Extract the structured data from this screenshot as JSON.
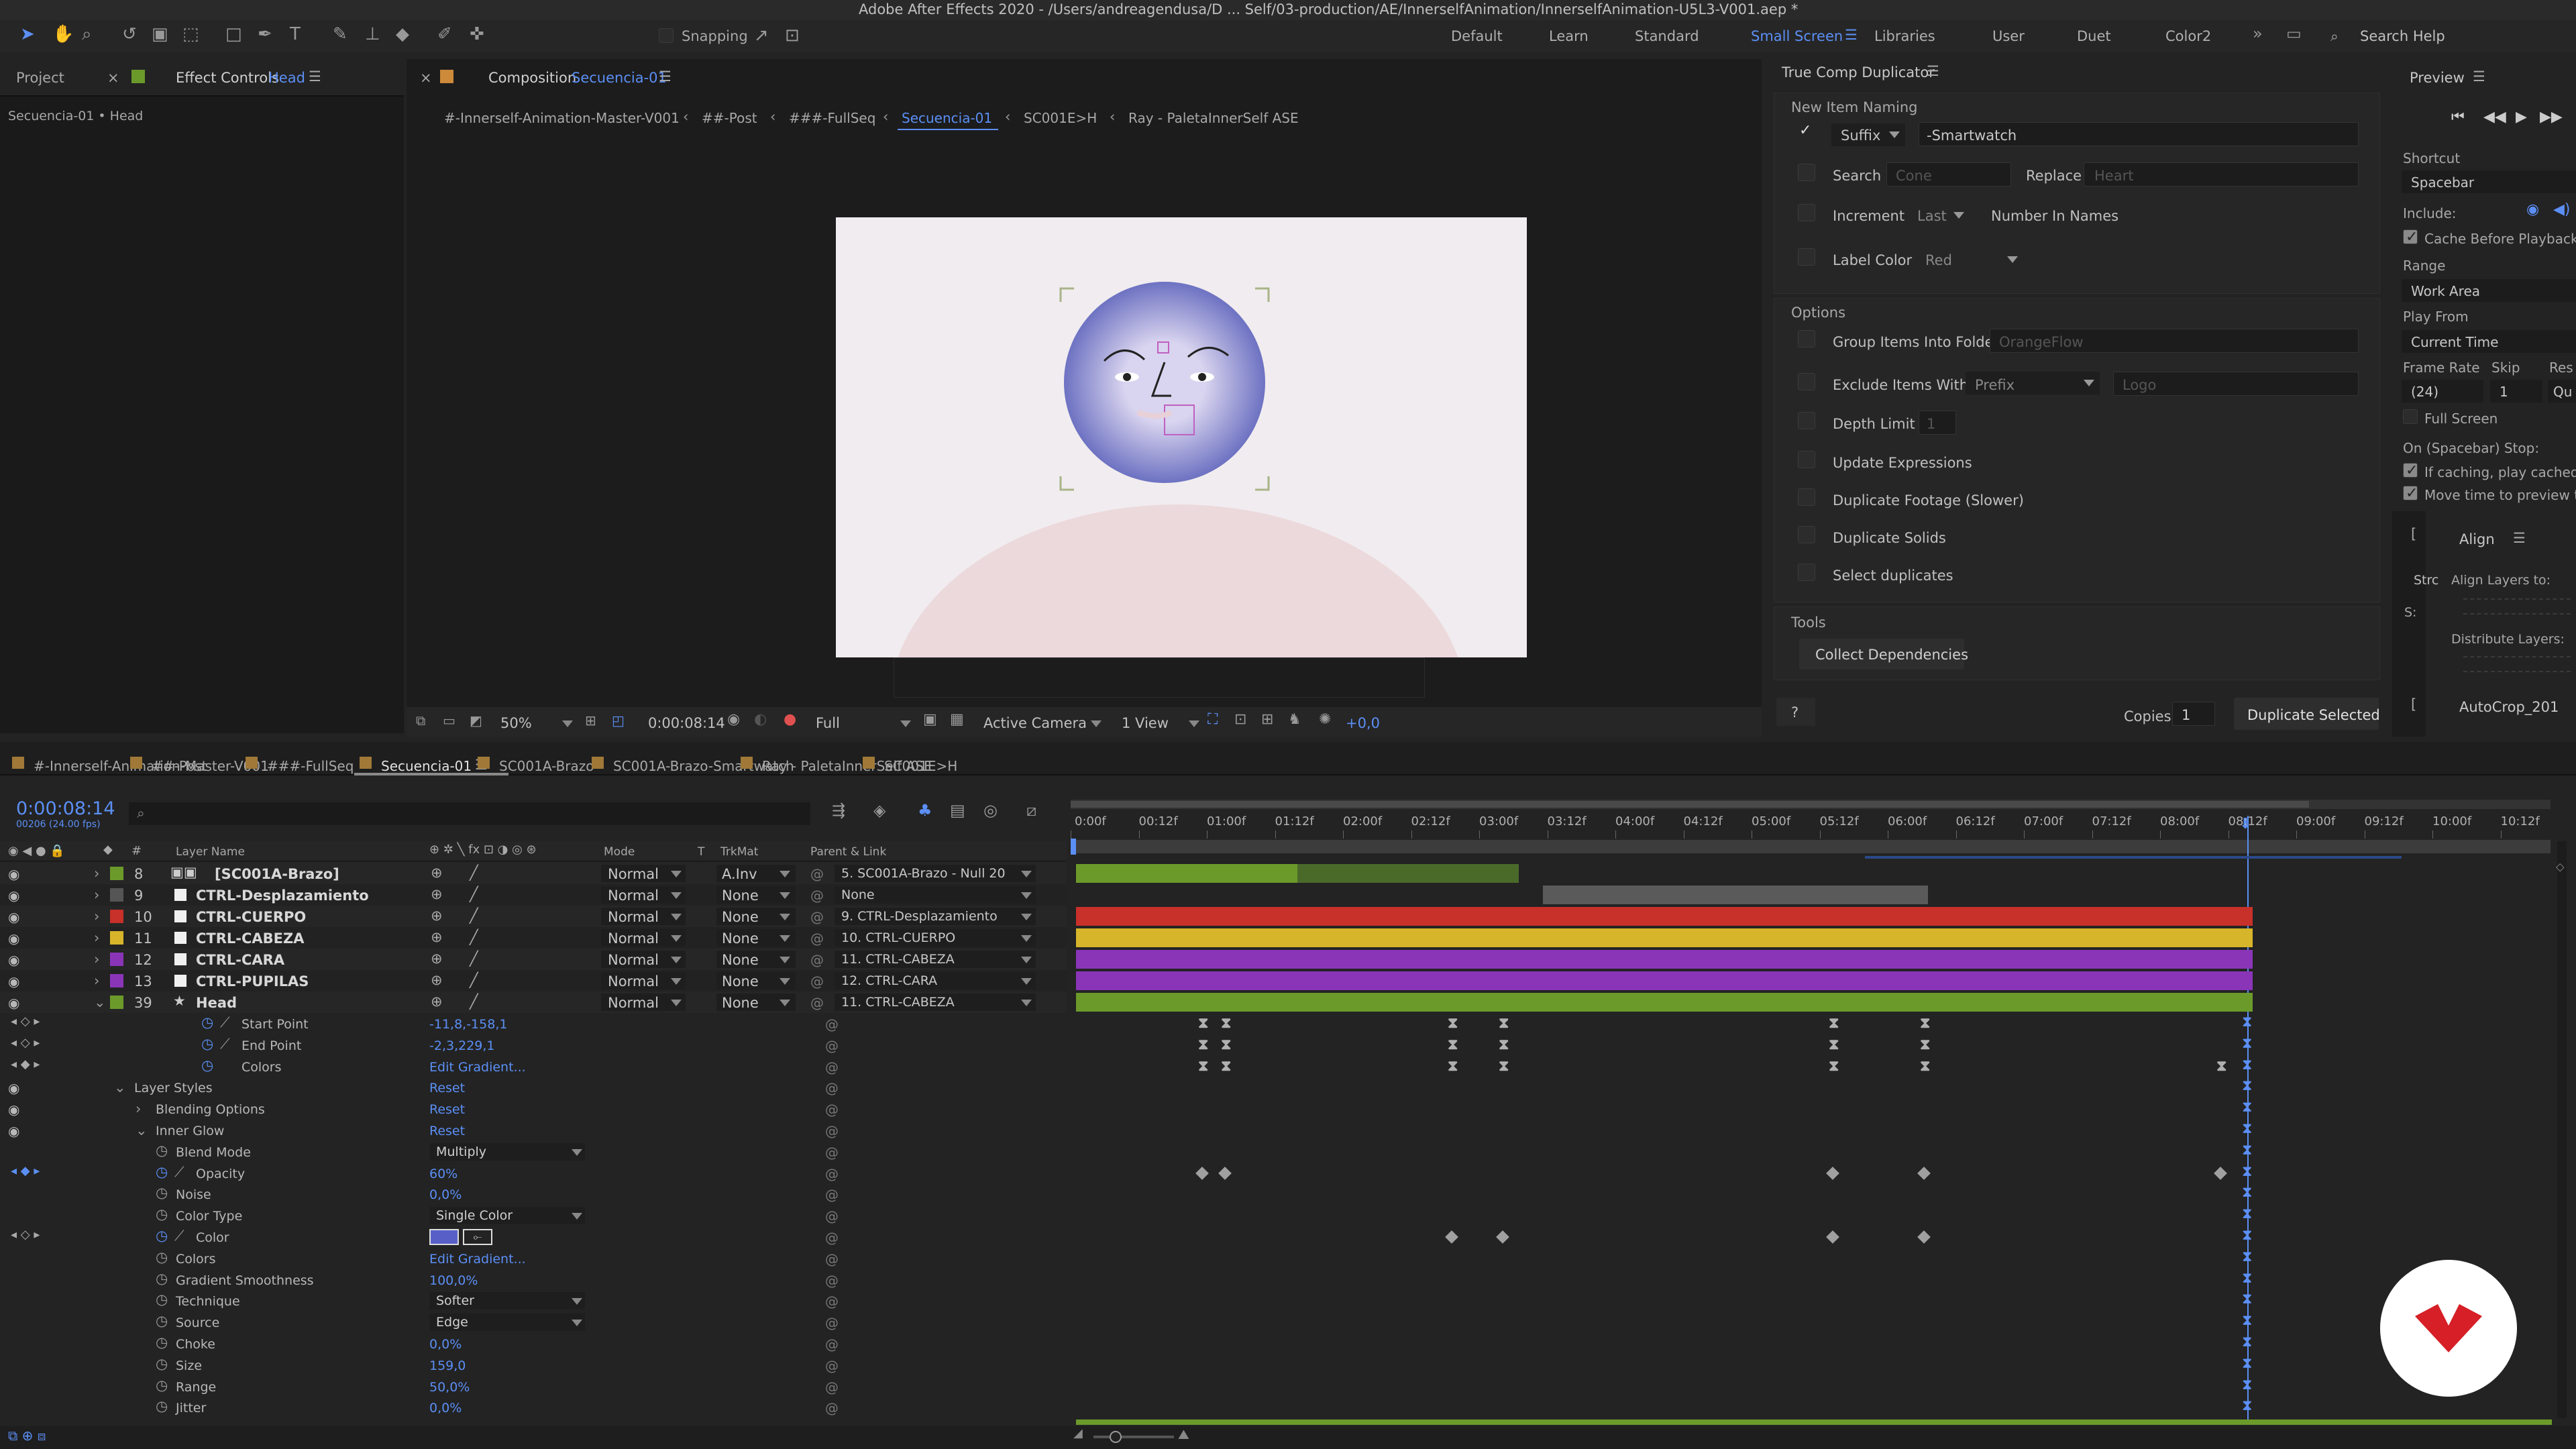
{
  "menubar": {
    "title": "Adobe After Effects 2020 - /Users/andreagendusa/D ... Self/03-production/AE/InnerselfAnimation/InnerselfAnimation-U5L3-V001.aep *"
  },
  "toolbar": {
    "snapping": "Snapping",
    "workspaces": [
      "Default",
      "Learn",
      "Standard",
      "Small Screen",
      "Libraries",
      "User",
      "Duet",
      "Color2"
    ],
    "active_workspace": "Small Screen",
    "search_placeholder": "Search Help"
  },
  "left_panel": {
    "tab_project": "Project",
    "tab_effect": "Effect Controls",
    "tab_effect_layer": "Head",
    "subtitle": "Secuencia-01 • Head"
  },
  "comp": {
    "tab_label": "Composition",
    "tab_name": "Secuencia-01",
    "breadcrumbs": [
      "#-Innerself-Animation-Master-V001",
      "##-Post",
      "###-FullSeq",
      "Secuencia-01",
      "SC001E>H",
      "Ray - PaletaInnerSelf ASE"
    ],
    "active_crumb": "Secuencia-01",
    "zoom": "50%",
    "timecode": "0:00:08:14",
    "resolution": "Full",
    "camera": "Active Camera",
    "views": "1 View",
    "exposure": "+0,0"
  },
  "tcd": {
    "title": "True Comp Duplicator",
    "section_naming": "New Item Naming",
    "suffix_label": "Suffix",
    "suffix_value": "-Smartwatch",
    "search_label": "Search",
    "search_placeholder": "Cone",
    "replace_label": "Replace",
    "replace_placeholder": "Heart",
    "increment_label": "Increment",
    "increment_value": "Last",
    "number_label": "Number In Names",
    "labelcolor_label": "Label Color",
    "labelcolor_value": "Red",
    "section_options": "Options",
    "group_label": "Group Items Into Folder",
    "group_placeholder": "OrangeFlow",
    "exclude_label": "Exclude Items With",
    "exclude_value": "Prefix",
    "exclude_placeholder": "Logo",
    "depth_label": "Depth Limit",
    "depth_value": "1",
    "update_expr": "Update Expressions",
    "dup_footage": "Duplicate Footage (Slower)",
    "dup_solids": "Duplicate Solids",
    "select_dups": "Select duplicates",
    "section_tools": "Tools",
    "collect_btn": "Collect Dependencies",
    "help_btn": "?",
    "copies_label": "Copies",
    "copies_value": "1",
    "dup_btn": "Duplicate Selected"
  },
  "preview": {
    "title": "Preview",
    "shortcut_label": "Shortcut",
    "shortcut_value": "Spacebar",
    "include_label": "Include:",
    "cache_label": "Cache Before Playback",
    "range_label": "Range",
    "range_value": "Work Area",
    "playfrom_label": "Play From",
    "playfrom_value": "Current Time",
    "framerate_label": "Frame Rate",
    "skip_label": "Skip",
    "res_label": "Res",
    "framerate_value": "(24)",
    "skip_value": "1",
    "res_value": "Qu",
    "fullscreen_label": "Full Screen",
    "stop_label": "On (Spacebar) Stop:",
    "ifcaching_label": "If caching, play cached f",
    "movetime_label": "Move time to preview ti"
  },
  "align": {
    "title": "Align",
    "align_to": "Align Layers to:",
    "distribute": "Distribute Layers:",
    "strc": "Strc",
    "s_label": "S:",
    "autocrop": "AutoCrop_201"
  },
  "timeline": {
    "tabs": [
      "#-Innerself-Animation-Master-V001",
      "##-Post",
      "###-FullSeq",
      "Secuencia-01",
      "SC001A-Brazo",
      "SC001A-Brazo-Smartwatch",
      "Ray - PaletaInnerSelf ASE",
      "SC001E>H"
    ],
    "active_tab": "Secuencia-01",
    "timecode": "0:00:08:14",
    "frames_fps": "00206 (24.00 fps)",
    "columns": {
      "layer_name": "Layer Name",
      "mode": "Mode",
      "t": "T",
      "trkmat": "TrkMat",
      "parent": "Parent & Link"
    },
    "ruler": [
      "0:00f",
      "00:12f",
      "01:00f",
      "01:12f",
      "02:00f",
      "02:12f",
      "03:00f",
      "03:12f",
      "04:00f",
      "04:12f",
      "05:00f",
      "05:12f",
      "06:00f",
      "06:12f",
      "07:00f",
      "07:12f",
      "08:00f",
      "08:12f",
      "09:00f",
      "09:12f",
      "10:00f",
      "10:12f"
    ],
    "layers": [
      {
        "num": "8",
        "name": "[SC001A-Brazo]",
        "mode": "Normal",
        "trkmat": "A.Inv",
        "parent": "5. SC001A-Brazo - Null 20",
        "color": "#6b9a2a"
      },
      {
        "num": "9",
        "name": "CTRL-Desplazamiento",
        "mode": "Normal",
        "trkmat": "None",
        "parent": "None",
        "color": "#555555"
      },
      {
        "num": "10",
        "name": "CTRL-CUERPO",
        "mode": "Normal",
        "trkmat": "None",
        "parent": "9. CTRL-Desplazamiento",
        "color": "#c8302a"
      },
      {
        "num": "11",
        "name": "CTRL-CABEZA",
        "mode": "Normal",
        "trkmat": "None",
        "parent": "10. CTRL-CUERPO",
        "color": "#d7b52a"
      },
      {
        "num": "12",
        "name": "CTRL-CARA",
        "mode": "Normal",
        "trkmat": "None",
        "parent": "11. CTRL-CABEZA",
        "color": "#8a35b8"
      },
      {
        "num": "13",
        "name": "CTRL-PUPILAS",
        "mode": "Normal",
        "trkmat": "None",
        "parent": "12. CTRL-CARA",
        "color": "#8a35b8"
      },
      {
        "num": "39",
        "name": "Head",
        "mode": "Normal",
        "trkmat": "None",
        "parent": "11. CTRL-CABEZA",
        "color": "#6b9a2a"
      }
    ],
    "props": [
      {
        "name": "Start Point",
        "value": "-11,8,-158,1"
      },
      {
        "name": "End Point",
        "value": "-2,3,229,1"
      },
      {
        "name": "Colors",
        "value": "Edit Gradient..."
      },
      {
        "name": "Layer Styles",
        "value": "Reset"
      },
      {
        "name": "Blending Options",
        "value": "Reset"
      },
      {
        "name": "Inner Glow",
        "value": "Reset"
      },
      {
        "name": "Blend Mode",
        "value": "Multiply"
      },
      {
        "name": "Opacity",
        "value": "60%"
      },
      {
        "name": "Noise",
        "value": "0,0%"
      },
      {
        "name": "Color Type",
        "value": "Single Color"
      },
      {
        "name": "Color",
        "value": ""
      },
      {
        "name": "Colors",
        "value": "Edit Gradient..."
      },
      {
        "name": "Gradient Smoothness",
        "value": "100,0%"
      },
      {
        "name": "Technique",
        "value": "Softer"
      },
      {
        "name": "Source",
        "value": "Edge"
      },
      {
        "name": "Choke",
        "value": "0,0%"
      },
      {
        "name": "Size",
        "value": "159,0"
      },
      {
        "name": "Range",
        "value": "50,0%"
      },
      {
        "name": "Jitter",
        "value": "0,0%"
      }
    ]
  },
  "colors": {
    "accent": "#5b8ff5",
    "green": "#6b9a2a",
    "red": "#c8302a",
    "yellow": "#d7b52a",
    "purple": "#8a35b8",
    "logo": "#d61f26"
  }
}
